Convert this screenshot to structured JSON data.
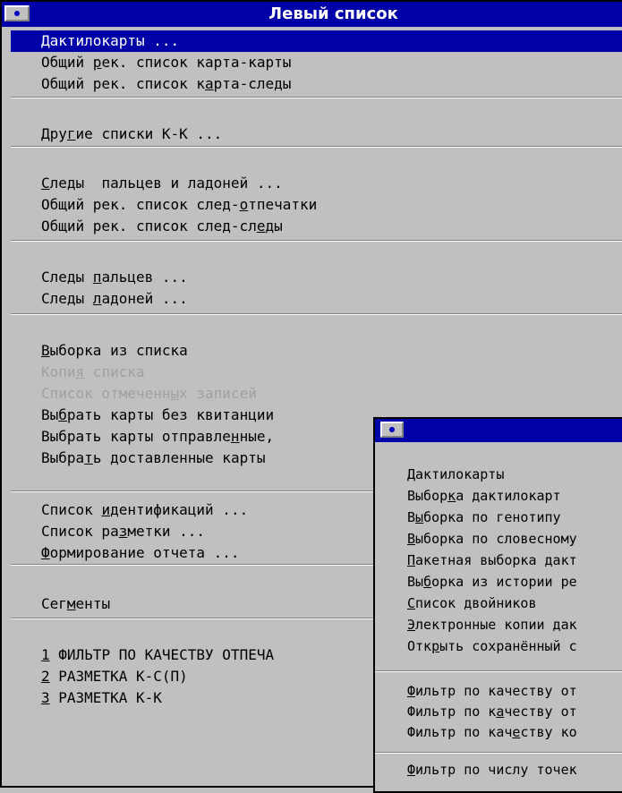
{
  "main_window": {
    "title": "Левый список",
    "items": [
      {
        "pre": "",
        "acc": "",
        "post": "Дактилокарты ..."
      },
      {
        "pre": "Общий ",
        "acc": "р",
        "post": "ек. список карта-карты"
      },
      {
        "pre": "Общий рек. список к",
        "acc": "а",
        "post": "рта-следы"
      },
      {
        "pre": "Дру",
        "acc": "г",
        "post": "ие списки К-К ..."
      },
      {
        "pre": "",
        "acc": "С",
        "post": "леды  пальцев и ладоней ..."
      },
      {
        "pre": "Общий рек. список след-",
        "acc": "о",
        "post": "тпечатки"
      },
      {
        "pre": "Общий рек. список след-сл",
        "acc": "е",
        "post": "ды"
      },
      {
        "pre": "Следы ",
        "acc": "п",
        "post": "альцев ..."
      },
      {
        "pre": "Следы ",
        "acc": "л",
        "post": "адоней ..."
      },
      {
        "pre": "",
        "acc": "В",
        "post": "ыборка из списка"
      },
      {
        "pre": "Копи",
        "acc": "я",
        "post": " списка"
      },
      {
        "pre": "Список отмеченн",
        "acc": "ы",
        "post": "х записей"
      },
      {
        "pre": "Вы",
        "acc": "б",
        "post": "рать карты без квитанции"
      },
      {
        "pre": "Выбрать карты отправле",
        "acc": "н",
        "post": "ные,"
      },
      {
        "pre": "Выбра",
        "acc": "т",
        "post": "ь доставленные карты"
      },
      {
        "pre": "Список ",
        "acc": "и",
        "post": "дентификаций ..."
      },
      {
        "pre": "Список ра",
        "acc": "з",
        "post": "метки ..."
      },
      {
        "pre": "",
        "acc": "Ф",
        "post": "ормирование отчета ..."
      },
      {
        "pre": "Сег",
        "acc": "м",
        "post": "енты"
      },
      {
        "pre": "",
        "acc": "1",
        "post": " ФИЛЬТР ПО КАЧЕСТВУ ОТПЕЧА"
      },
      {
        "pre": "",
        "acc": "2",
        "post": " РАЗМЕТКА К-С(П)"
      },
      {
        "pre": "",
        "acc": "3",
        "post": " РАЗМЕТКА К-К"
      }
    ]
  },
  "sub_window": {
    "title": "",
    "items": [
      {
        "pre": "",
        "acc": "Д",
        "post": "актилокарты"
      },
      {
        "pre": "Выбор",
        "acc": "к",
        "post": "а дактилокарт"
      },
      {
        "pre": "В",
        "acc": "ы",
        "post": "борка по генотипу"
      },
      {
        "pre": "",
        "acc": "В",
        "post": "ыборка по словесному"
      },
      {
        "pre": "",
        "acc": "П",
        "post": "акетная выборка дакт"
      },
      {
        "pre": "Вы",
        "acc": "б",
        "post": "орка из истории ре"
      },
      {
        "pre": "",
        "acc": "С",
        "post": "писок двойников"
      },
      {
        "pre": "",
        "acc": "Э",
        "post": "лектронные копии дак"
      },
      {
        "pre": "Отк",
        "acc": "р",
        "post": "ыть сохранённый с"
      },
      {
        "pre": "",
        "acc": "Ф",
        "post": "ильтр по качеству от"
      },
      {
        "pre": "Фильтр по к",
        "acc": "а",
        "post": "честву от"
      },
      {
        "pre": "Фильтр по кач",
        "acc": "е",
        "post": "ству ко"
      },
      {
        "pre": "",
        "acc": "Ф",
        "post": "ильтр по числу точек"
      }
    ]
  }
}
